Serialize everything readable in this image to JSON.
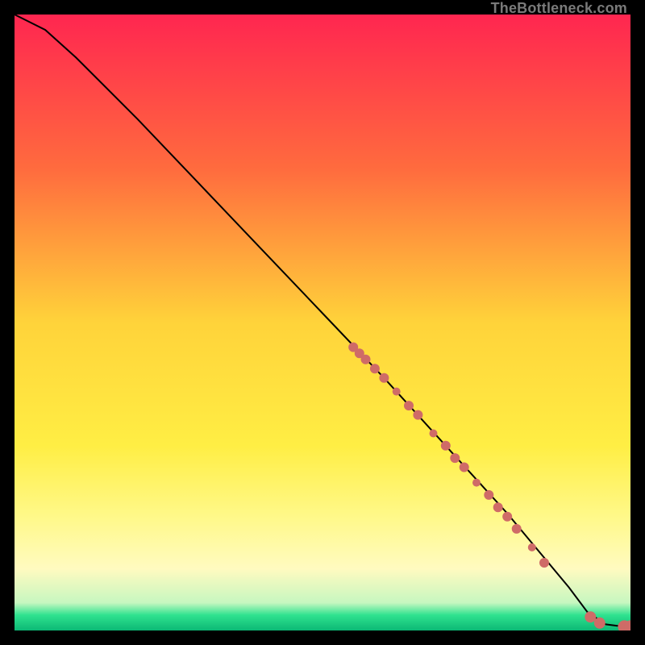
{
  "watermark": "TheBottleneck.com",
  "chart_data": {
    "type": "line",
    "title": "",
    "xlabel": "",
    "ylabel": "",
    "xlim": [
      0,
      100
    ],
    "ylim": [
      0,
      100
    ],
    "background_gradient": {
      "stops": [
        {
          "pos": 0.0,
          "color": "#ff2650"
        },
        {
          "pos": 0.25,
          "color": "#ff6b3e"
        },
        {
          "pos": 0.5,
          "color": "#ffd33a"
        },
        {
          "pos": 0.7,
          "color": "#ffee44"
        },
        {
          "pos": 0.82,
          "color": "#fff98c"
        },
        {
          "pos": 0.9,
          "color": "#fffac0"
        },
        {
          "pos": 0.955,
          "color": "#c7f7c0"
        },
        {
          "pos": 0.975,
          "color": "#2fe28f"
        },
        {
          "pos": 1.0,
          "color": "#0cb875"
        }
      ]
    },
    "series": [
      {
        "name": "curve",
        "color": "#000000",
        "x": [
          0,
          2,
          5,
          10,
          20,
          30,
          40,
          50,
          60,
          70,
          80,
          90,
          93,
          96,
          100
        ],
        "y": [
          100,
          99,
          97.5,
          93,
          83,
          72.5,
          62,
          51.5,
          41,
          30,
          19,
          7,
          3,
          1,
          0.5
        ]
      }
    ],
    "markers": {
      "name": "cluster",
      "color": "#cf6b67",
      "radius_small": 5,
      "radius_large": 8,
      "points": [
        {
          "x": 55,
          "y": 46,
          "r": 6
        },
        {
          "x": 56,
          "y": 45,
          "r": 6
        },
        {
          "x": 57,
          "y": 44,
          "r": 6
        },
        {
          "x": 58.5,
          "y": 42.5,
          "r": 6
        },
        {
          "x": 60,
          "y": 41,
          "r": 6
        },
        {
          "x": 62,
          "y": 38.8,
          "r": 5
        },
        {
          "x": 64,
          "y": 36.5,
          "r": 6
        },
        {
          "x": 65.5,
          "y": 35,
          "r": 6
        },
        {
          "x": 68,
          "y": 32,
          "r": 5
        },
        {
          "x": 70,
          "y": 30,
          "r": 6
        },
        {
          "x": 71.5,
          "y": 28,
          "r": 6
        },
        {
          "x": 73,
          "y": 26.5,
          "r": 6
        },
        {
          "x": 75,
          "y": 24,
          "r": 5
        },
        {
          "x": 77,
          "y": 22,
          "r": 6
        },
        {
          "x": 78.5,
          "y": 20,
          "r": 6
        },
        {
          "x": 80,
          "y": 18.5,
          "r": 6
        },
        {
          "x": 81.5,
          "y": 16.5,
          "r": 6
        },
        {
          "x": 84,
          "y": 13.5,
          "r": 5
        },
        {
          "x": 86,
          "y": 11,
          "r": 6
        },
        {
          "x": 93.5,
          "y": 2.2,
          "r": 7
        },
        {
          "x": 95,
          "y": 1.2,
          "r": 7
        },
        {
          "x": 99,
          "y": 0.6,
          "r": 8
        },
        {
          "x": 100,
          "y": 0.6,
          "r": 8
        }
      ]
    }
  }
}
